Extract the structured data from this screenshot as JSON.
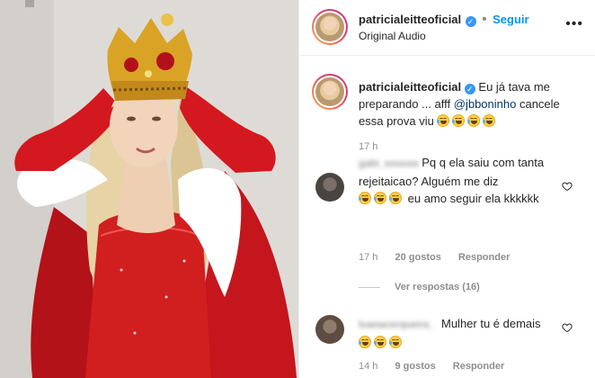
{
  "post": {
    "username": "patricialeitteoficial",
    "follow_label": "Seguir",
    "follow_separator": "•",
    "audio": "Original Audio",
    "more_label": "•••"
  },
  "caption": {
    "username": "patricialeitteoficial",
    "text_before": "Eu já tava me preparando ... afff ",
    "mention": "@jbboninho",
    "text_after": " cancele essa prova viu",
    "emoji_count": 4,
    "time": "17 h"
  },
  "comments": [
    {
      "username": "gabi_souuza",
      "text": "Pq q ela saiu com tanta rejeitaicao? Alguém me diz",
      "text_tail": " eu amo seguir ela kkkkkk",
      "emoji_count": 3,
      "time": "17 h",
      "likes": "20 gostos",
      "reply": "Responder",
      "view_replies": "Ver respostas (16)"
    },
    {
      "username": "luanacerqueira_",
      "text": "Mulher tu é demais",
      "emoji_count": 3,
      "time": "14 h",
      "likes": "9 gostos",
      "reply": "Responder"
    }
  ],
  "icons": {
    "verified": "verified-badge-icon",
    "more": "more-options-icon",
    "like": "heart-icon"
  },
  "colors": {
    "accent_blue": "#0095f6",
    "verified_blue": "#3897f0",
    "muted": "#8e8e8e",
    "dress_red": "#d11f1f",
    "crown_gold": "#d9a326"
  }
}
